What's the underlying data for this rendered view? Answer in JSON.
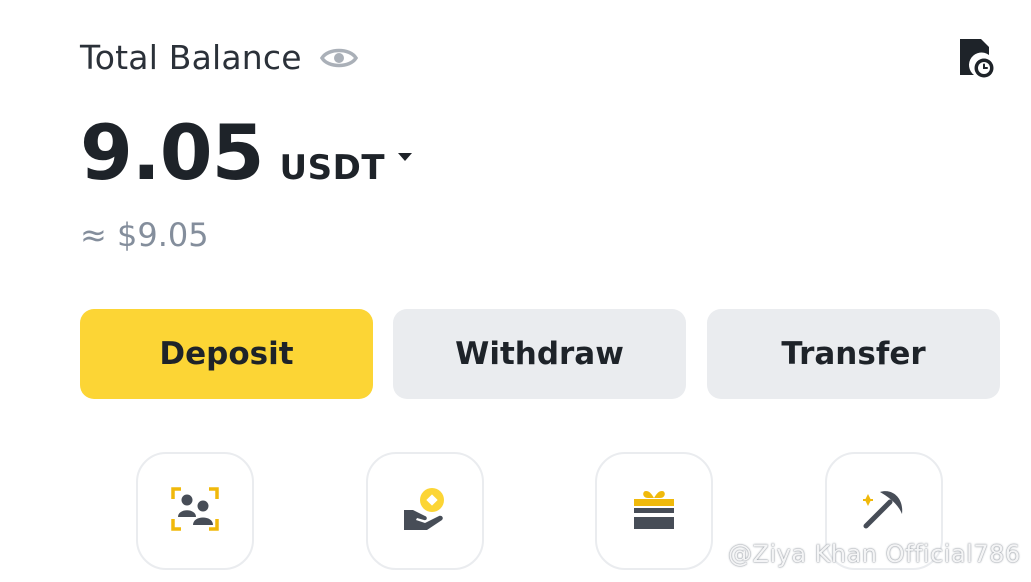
{
  "header": {
    "title": "Total Balance",
    "eye_icon": "eye-icon",
    "history_icon": "document-clock-icon"
  },
  "balance": {
    "amount": "9.05",
    "currency": "USDT",
    "approx": "≈ $9.05"
  },
  "actions": {
    "deposit": "Deposit",
    "withdraw": "Withdraw",
    "transfer": "Transfer"
  },
  "shortcuts": [
    {
      "icon": "users-scan-icon"
    },
    {
      "icon": "coin-hand-icon"
    },
    {
      "icon": "gift-card-icon"
    },
    {
      "icon": "pickaxe-icon"
    }
  ],
  "watermark": "@Ziya Khan Official786",
  "colors": {
    "accent": "#fcd535",
    "secondary_button": "#eaecef",
    "text_primary": "#1e2329",
    "text_muted": "#848e9c",
    "icon_dark": "#474d57"
  }
}
